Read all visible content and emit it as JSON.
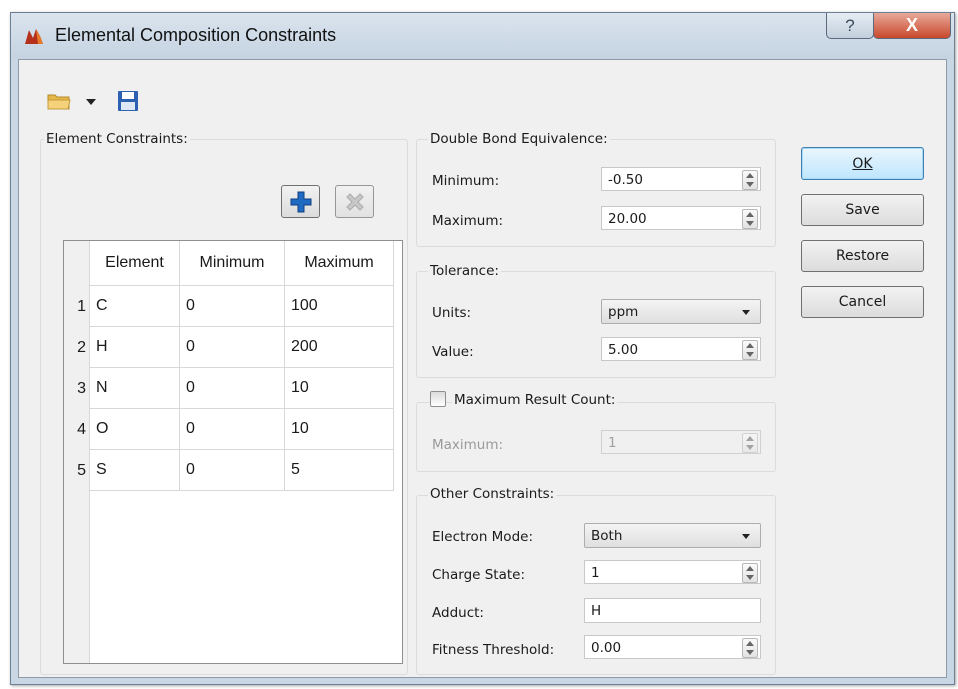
{
  "window": {
    "title": "Elemental Composition Constraints",
    "help_label": "?",
    "close_label": "X"
  },
  "toolbar": {
    "open_icon": "folder-open-icon",
    "dropdown_icon": "chevron-down-icon",
    "save_icon": "floppy-disk-icon"
  },
  "element_constraints": {
    "label": "Element Constraints:",
    "add_icon": "plus-icon",
    "remove_icon": "x-icon",
    "columns": [
      "Element",
      "Minimum",
      "Maximum"
    ],
    "rows": [
      {
        "n": "1",
        "element": "C",
        "min": "0",
        "max": "100"
      },
      {
        "n": "2",
        "element": "H",
        "min": "0",
        "max": "200"
      },
      {
        "n": "3",
        "element": "N",
        "min": "0",
        "max": "10"
      },
      {
        "n": "4",
        "element": "O",
        "min": "0",
        "max": "10"
      },
      {
        "n": "5",
        "element": "S",
        "min": "0",
        "max": "5"
      }
    ]
  },
  "dbe": {
    "label": "Double Bond Equivalence:",
    "min_label": "Minimum:",
    "min_value": "-0.50",
    "max_label": "Maximum:",
    "max_value": "20.00"
  },
  "tolerance": {
    "label": "Tolerance:",
    "units_label": "Units:",
    "units_value": "ppm",
    "value_label": "Value:",
    "value": "5.00"
  },
  "max_result": {
    "label": "Maximum Result Count:",
    "checked": false,
    "max_label": "Maximum:",
    "max_value": "1"
  },
  "other": {
    "label": "Other Constraints:",
    "electron_mode_label": "Electron Mode:",
    "electron_mode_value": "Both",
    "charge_label": "Charge State:",
    "charge_value": "1",
    "adduct_label": "Adduct:",
    "adduct_value": "H",
    "fitness_label": "Fitness Threshold:",
    "fitness_value": "0.00"
  },
  "buttons": {
    "ok": "OK",
    "save": "Save",
    "restore": "Restore",
    "cancel": "Cancel"
  }
}
